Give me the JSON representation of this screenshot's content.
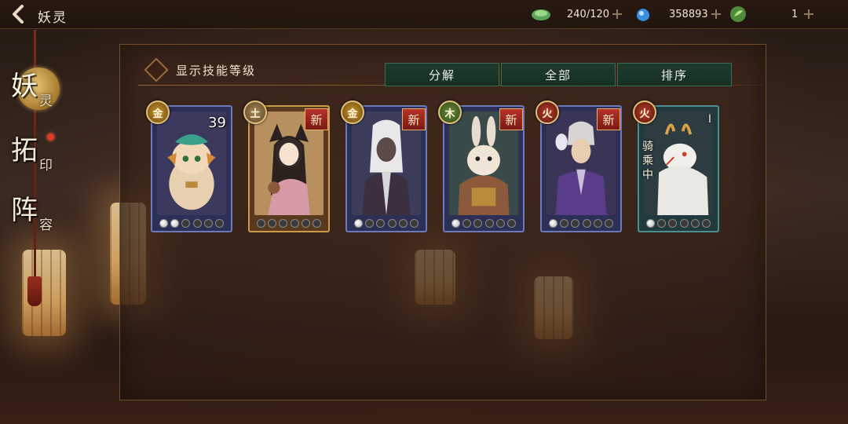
{
  "header": {
    "title": "妖灵",
    "resources": [
      {
        "icon": "jade-icon",
        "value": "240/120"
      },
      {
        "icon": "spirit-pouch-icon",
        "value": "358893"
      },
      {
        "icon": "leaf-token-icon",
        "value": "1"
      }
    ]
  },
  "sidebar": {
    "items": [
      {
        "big": "妖",
        "small": "灵",
        "active": true
      },
      {
        "big": "拓",
        "small": "印",
        "active": false
      },
      {
        "big": "阵",
        "small": "容",
        "active": false
      }
    ]
  },
  "panel": {
    "toggle_label": "显示技能等级",
    "tabs": [
      "分解",
      "全部",
      "排序"
    ]
  },
  "cards": [
    {
      "element": "金",
      "level": "39",
      "new": "",
      "status": "",
      "star": "",
      "skills_on": 2
    },
    {
      "element": "土",
      "level": "",
      "new": "新",
      "status": "",
      "star": "",
      "skills_on": 0
    },
    {
      "element": "金",
      "level": "",
      "new": "新",
      "status": "",
      "star": "",
      "skills_on": 1
    },
    {
      "element": "木",
      "level": "",
      "new": "新",
      "status": "",
      "star": "",
      "skills_on": 1
    },
    {
      "element": "火",
      "level": "",
      "new": "新",
      "status": "",
      "star": "",
      "skills_on": 1
    },
    {
      "element": "火",
      "level": "",
      "new": "",
      "status": "骑乘中",
      "star": "I",
      "skills_on": 1
    }
  ],
  "colors": {
    "tab_bg": "#1f3a2c",
    "accent_gold": "#c7952c",
    "new_badge": "#b7322a"
  }
}
